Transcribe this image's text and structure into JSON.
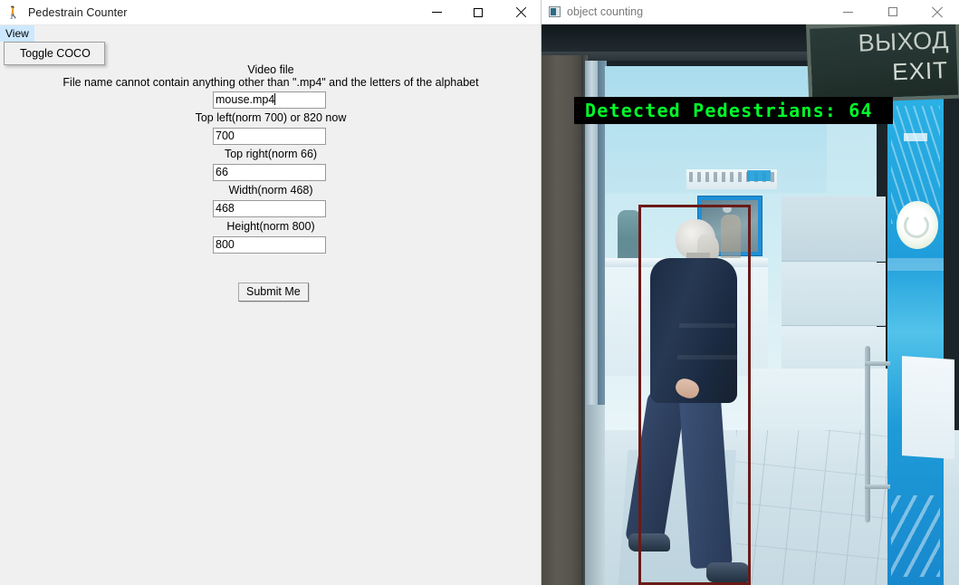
{
  "left_window": {
    "title": "Pedestrain Counter",
    "icon": "pedestrian-icon",
    "controls": {
      "minimize": "minimize-icon",
      "maximize": "maximize-icon",
      "close": "close-icon"
    },
    "menubar": {
      "items": [
        {
          "label": "View",
          "active": true
        }
      ]
    },
    "dropdown": {
      "open": true,
      "items": [
        {
          "label": "Toggle COCO"
        }
      ]
    },
    "form": {
      "video_label": "Video file",
      "warning": "File name cannot contain anything other than \".mp4\" and the letters of the alphabet",
      "fields": [
        {
          "label": "",
          "value": "mouse.mp4",
          "name": "video-file-input",
          "focused": true
        },
        {
          "label": "Top left(norm 700) or 820 now",
          "value": "700",
          "name": "top-left-input",
          "focused": false
        },
        {
          "label": "Top right(norm 66)",
          "value": "66",
          "name": "top-right-input",
          "focused": false
        },
        {
          "label": "Width(norm 468)",
          "value": "468",
          "name": "width-input",
          "focused": false
        },
        {
          "label": "Height(norm 800)",
          "value": "800",
          "name": "height-input",
          "focused": false
        }
      ],
      "submit_label": "Submit Me"
    }
  },
  "right_window": {
    "title": "object counting",
    "icon": "opencv-window-icon",
    "controls": {
      "minimize": "minimize-icon",
      "maximize": "maximize-icon",
      "close": "close-icon"
    },
    "video": {
      "overlay_text": "Detected Pedestrians: 64",
      "overlay_color": "#00ff2a",
      "overlay_bg": "#000000",
      "bbox_color": "#6b1a17",
      "exit_sign": {
        "russian": "ВЫХОД",
        "english": "EXIT"
      }
    }
  }
}
